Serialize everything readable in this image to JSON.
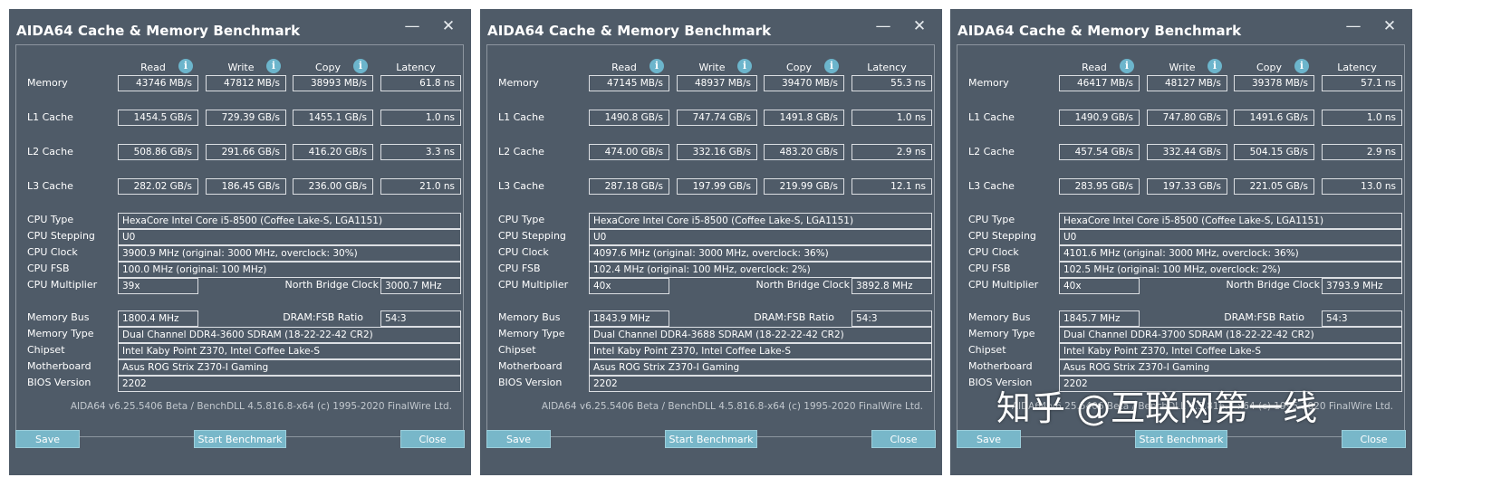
{
  "title": "AIDA64 Cache & Memory Benchmark",
  "headers": [
    "Read",
    "Write",
    "Copy",
    "Latency"
  ],
  "rows": [
    "Memory",
    "L1 Cache",
    "L2 Cache",
    "L3 Cache"
  ],
  "labels": {
    "cpu_type": "CPU Type",
    "cpu_stepping": "CPU Stepping",
    "cpu_clock": "CPU Clock",
    "cpu_fsb": "CPU FSB",
    "cpu_multiplier": "CPU Multiplier",
    "north_bridge_clock": "North Bridge Clock",
    "memory_bus": "Memory Bus",
    "dram_fsb_ratio": "DRAM:FSB Ratio",
    "memory_type": "Memory Type",
    "chipset": "Chipset",
    "motherboard": "Motherboard",
    "bios_version": "BIOS Version"
  },
  "buttons": {
    "save": "Save",
    "start": "Start Benchmark",
    "close": "Close"
  },
  "controls": {
    "minimize": "—",
    "close": "✕"
  },
  "info_icon": "i",
  "footer": "AIDA64 v6.25.5406 Beta / BenchDLL 4.5.816.8-x64  (c) 1995-2020 FinalWire Ltd.",
  "watermark": "知乎 @互联网第一线",
  "colors": {
    "window_bg": "#4f5b68",
    "button_bg": "#78b7c9",
    "info_icon": "#6cb5cc"
  },
  "windows": [
    {
      "bench": [
        [
          "43746 MB/s",
          "47812 MB/s",
          "38993 MB/s",
          "61.8 ns"
        ],
        [
          "1454.5 GB/s",
          "729.39 GB/s",
          "1455.1 GB/s",
          "1.0 ns"
        ],
        [
          "508.86 GB/s",
          "291.66 GB/s",
          "416.20 GB/s",
          "3.3 ns"
        ],
        [
          "282.02 GB/s",
          "186.45 GB/s",
          "236.00 GB/s",
          "21.0 ns"
        ]
      ],
      "cpu_type": "HexaCore Intel Core i5-8500  (Coffee Lake-S, LGA1151)",
      "cpu_stepping": "U0",
      "cpu_clock": "3900.9 MHz  (original: 3000 MHz, overclock: 30%)",
      "cpu_fsb": "100.0 MHz  (original: 100 MHz)",
      "cpu_multiplier": "39x",
      "north_bridge_clock": "3000.7 MHz",
      "memory_bus": "1800.4 MHz",
      "dram_fsb_ratio": "54:3",
      "memory_type": "Dual Channel DDR4-3600 SDRAM  (18-22-22-42 CR2)",
      "chipset": "Intel Kaby Point Z370, Intel Coffee Lake-S",
      "motherboard": "Asus ROG Strix Z370-I Gaming",
      "bios_version": "2202"
    },
    {
      "bench": [
        [
          "47145 MB/s",
          "48937 MB/s",
          "39470 MB/s",
          "55.3 ns"
        ],
        [
          "1490.8 GB/s",
          "747.74 GB/s",
          "1491.8 GB/s",
          "1.0 ns"
        ],
        [
          "474.00 GB/s",
          "332.16 GB/s",
          "483.20 GB/s",
          "2.9 ns"
        ],
        [
          "287.18 GB/s",
          "197.99 GB/s",
          "219.99 GB/s",
          "12.1 ns"
        ]
      ],
      "cpu_type": "HexaCore Intel Core i5-8500  (Coffee Lake-S, LGA1151)",
      "cpu_stepping": "U0",
      "cpu_clock": "4097.6 MHz  (original: 3000 MHz, overclock: 36%)",
      "cpu_fsb": "102.4 MHz  (original: 100 MHz, overclock: 2%)",
      "cpu_multiplier": "40x",
      "north_bridge_clock": "3892.8 MHz",
      "memory_bus": "1843.9 MHz",
      "dram_fsb_ratio": "54:3",
      "memory_type": "Dual Channel DDR4-3688 SDRAM  (18-22-22-42 CR2)",
      "chipset": "Intel Kaby Point Z370, Intel Coffee Lake-S",
      "motherboard": "Asus ROG Strix Z370-I Gaming",
      "bios_version": "2202"
    },
    {
      "bench": [
        [
          "46417 MB/s",
          "48127 MB/s",
          "39378 MB/s",
          "57.1 ns"
        ],
        [
          "1490.9 GB/s",
          "747.80 GB/s",
          "1491.6 GB/s",
          "1.0 ns"
        ],
        [
          "457.54 GB/s",
          "332.44 GB/s",
          "504.15 GB/s",
          "2.9 ns"
        ],
        [
          "283.95 GB/s",
          "197.33 GB/s",
          "221.05 GB/s",
          "13.0 ns"
        ]
      ],
      "cpu_type": "HexaCore Intel Core i5-8500  (Coffee Lake-S, LGA1151)",
      "cpu_stepping": "U0",
      "cpu_clock": "4101.6 MHz  (original: 3000 MHz, overclock: 36%)",
      "cpu_fsb": "102.5 MHz  (original: 100 MHz, overclock: 2%)",
      "cpu_multiplier": "40x",
      "north_bridge_clock": "3793.9 MHz",
      "memory_bus": "1845.7 MHz",
      "dram_fsb_ratio": "54:3",
      "memory_type": "Dual Channel DDR4-3700 SDRAM  (18-22-22-42 CR2)",
      "chipset": "Intel Kaby Point Z370, Intel Coffee Lake-S",
      "motherboard": "Asus ROG Strix Z370-I Gaming",
      "bios_version": "2202"
    }
  ]
}
